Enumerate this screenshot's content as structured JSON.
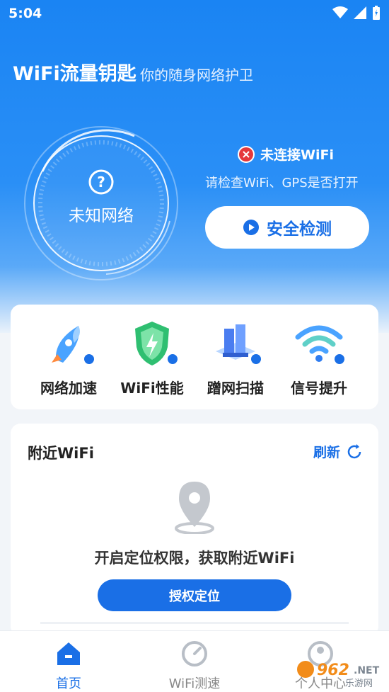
{
  "status_bar": {
    "time": "5:04"
  },
  "header": {
    "title": "WiFi流量钥匙",
    "subtitle": "你的随身网络护卫"
  },
  "gauge": {
    "label": "未知网络"
  },
  "connection": {
    "status": "未连接WiFi",
    "hint": "请检查WiFi、GPS是否打开"
  },
  "scan_button": {
    "label": "安全检测"
  },
  "tools": [
    {
      "label": "网络加速",
      "icon": "rocket-icon"
    },
    {
      "label": "WiFi性能",
      "icon": "shield-bolt-icon"
    },
    {
      "label": "蹭网扫描",
      "icon": "server-scan-icon"
    },
    {
      "label": "信号提升",
      "icon": "wifi-signal-icon"
    }
  ],
  "nearby": {
    "title": "附近WiFi",
    "refresh_label": "刷新",
    "permission_text": "开启定位权限，获取附近WiFi",
    "authorize_label": "授权定位"
  },
  "tabbar": {
    "tabs": [
      {
        "label": "首页",
        "active": true
      },
      {
        "label": "WiFi测速",
        "active": false
      },
      {
        "label": "个人中心",
        "active": false
      }
    ]
  },
  "watermark": {
    "text": "962.NET",
    "sub": "乐游网"
  },
  "colors": {
    "primary": "#1a6fe6",
    "hero": "#1a84f3",
    "error": "#e5383b"
  }
}
